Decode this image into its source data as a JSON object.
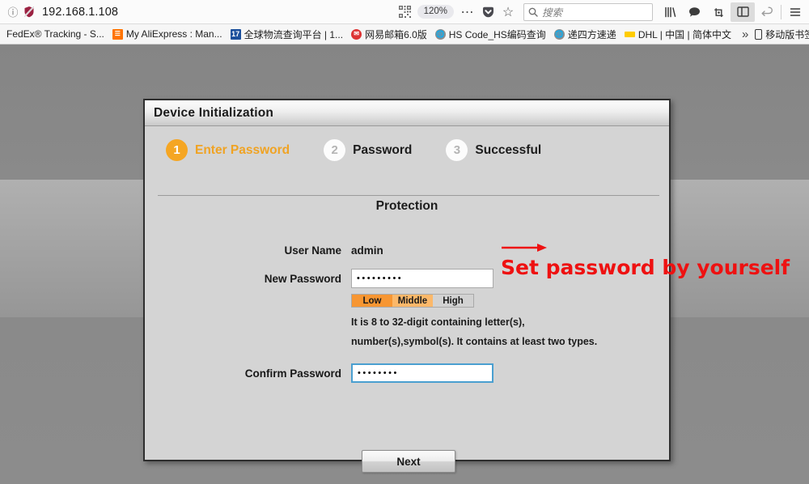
{
  "browser": {
    "url": "192.168.1.108",
    "zoom_level": "120%",
    "search_placeholder": "搜索",
    "icons": {
      "info": "info-icon",
      "tracking_protection": "shield-slash-icon",
      "qr": "qr-code-icon",
      "ellipsis": "…",
      "pocket": "pocket-icon",
      "star": "☆",
      "magnifier": "search-icon",
      "library": "library-icon",
      "chat": "chat-icon",
      "screenshot": "screenshot-icon",
      "sidebar": "sidebar-toggle-icon",
      "undo": "undo-icon",
      "menu": "hamburger-menu-icon"
    },
    "bookmarks": [
      {
        "label": "FedEx® Tracking - S...",
        "icon": "none"
      },
      {
        "label": "My AliExpress : Man...",
        "icon": "aliexpress"
      },
      {
        "label": "全球物流查询平台 | 1...",
        "icon": "seventeen",
        "icon_text": "17"
      },
      {
        "label": "网易邮箱6.0版",
        "icon": "netease"
      },
      {
        "label": "HS Code_HS编码查询",
        "icon": "globe"
      },
      {
        "label": "递四方速递",
        "icon": "globe"
      },
      {
        "label": "DHL | 中国 | 简体中文",
        "icon": "dhl"
      }
    ],
    "bookmarks_overflow": "»",
    "mobile_bookmarks": "移动版书签"
  },
  "dialog": {
    "title": "Device Initialization",
    "steps": [
      {
        "number": "1",
        "label": "Enter Password",
        "state": "active"
      },
      {
        "number": "2",
        "label": "Password",
        "state": "inactive"
      },
      {
        "number": "3",
        "label": "Successful",
        "state": "inactive"
      }
    ],
    "section_heading": "Protection",
    "fields": {
      "user_name_label": "User Name",
      "user_name_value": "admin",
      "new_password_label": "New Password",
      "new_password_value": "•••••••••",
      "confirm_password_label": "Confirm Password",
      "confirm_password_value": "••••••••"
    },
    "strength": {
      "low": "Low",
      "middle": "Middle",
      "high": "High",
      "selected": "Middle"
    },
    "password_hint": "It is 8 to 32-digit containing letter(s), number(s),symbol(s). It contains at least two types.",
    "next_button": "Next"
  },
  "annotation": {
    "text": "Set password by yourself",
    "color": "#ee1111"
  },
  "colors": {
    "accent_orange": "#f5a623",
    "focus_blue": "#4a9fd0",
    "strength_low": "#f79632",
    "strength_middle": "#fbb86a",
    "strength_high": "#d2d2d2",
    "dialog_bg": "#d4d4d4"
  }
}
